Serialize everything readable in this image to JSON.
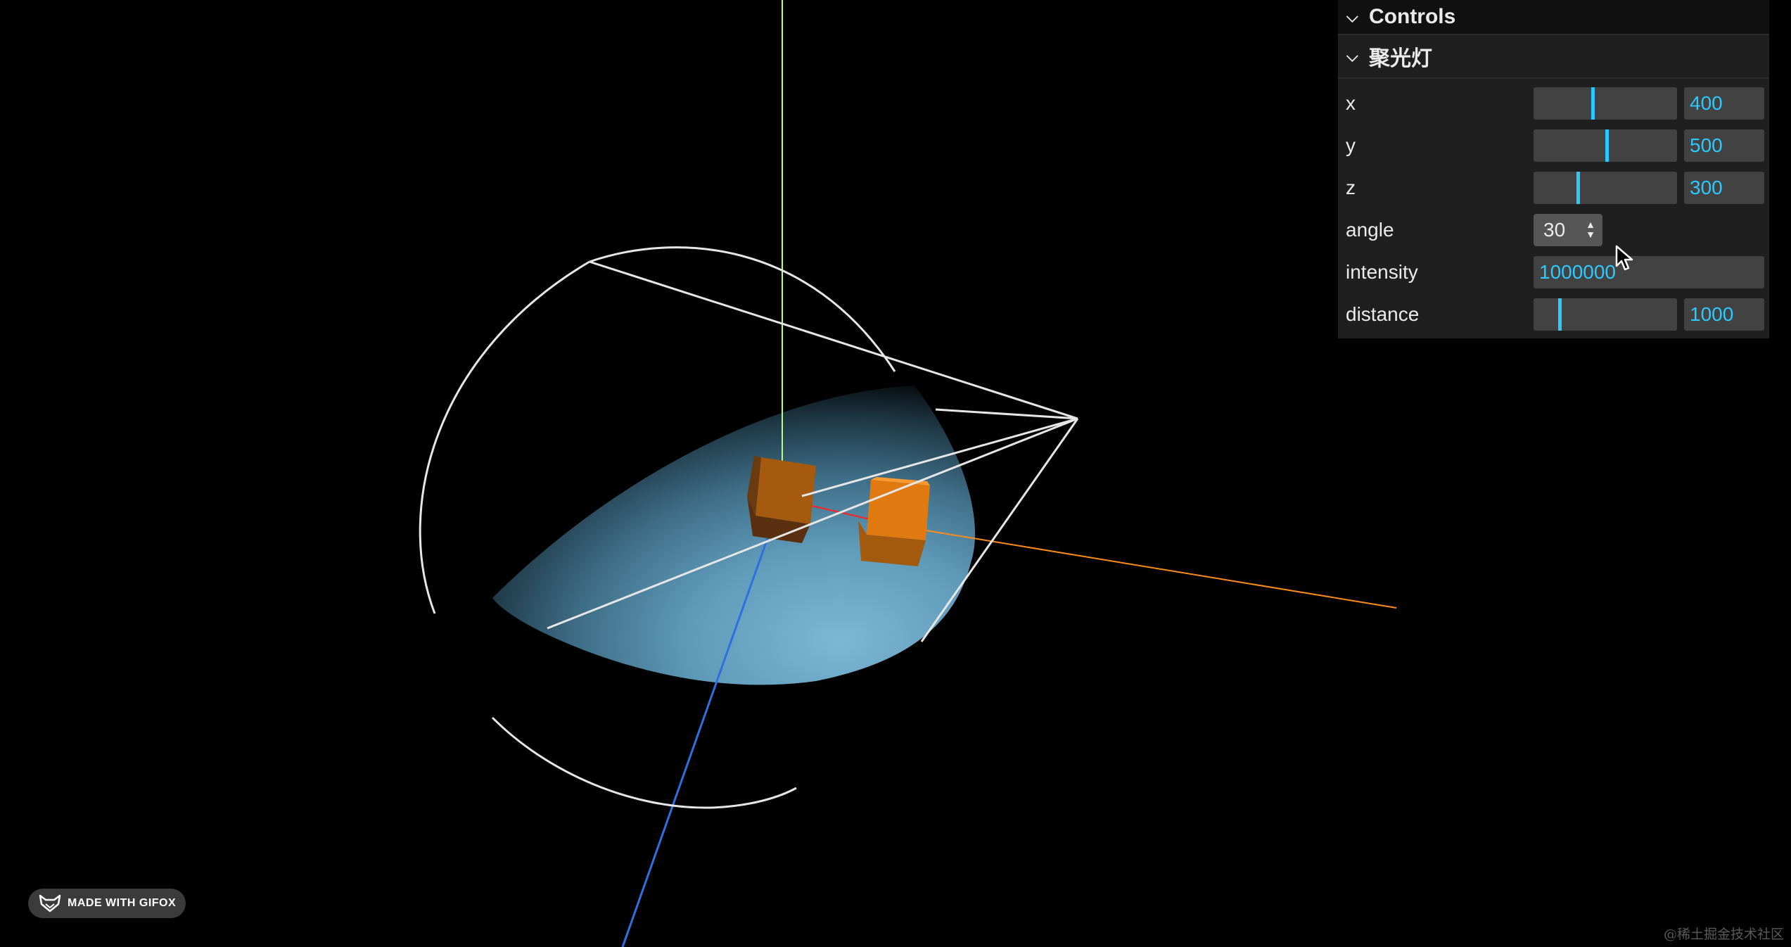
{
  "gui": {
    "title": "Controls",
    "folder_title": "聚光灯",
    "params": {
      "x": {
        "label": "x",
        "value": "400",
        "fraction": 0.4
      },
      "y": {
        "label": "y",
        "value": "500",
        "fraction": 0.5
      },
      "z": {
        "label": "z",
        "value": "300",
        "fraction": 0.3
      },
      "angle": {
        "label": "angle",
        "value": "30"
      },
      "intensity": {
        "label": "intensity",
        "value": "1000000"
      },
      "distance": {
        "label": "distance",
        "value": "1000",
        "fraction": 0.17
      }
    }
  },
  "badge": {
    "text": "MADE WITH GIFOX"
  },
  "watermark": {
    "text": "@稀土掘金技术社区"
  },
  "colors": {
    "accent": "#2cc9ff",
    "panel_bg": "#1f1f1f",
    "input_bg": "#424242",
    "cube": "#e07a10",
    "axis_x": "#ff8c1a",
    "axis_y": "#b8ff7a",
    "axis_z": "#2f6fe0"
  },
  "icons": {
    "folder_chevron": "chevron-down-icon",
    "select_arrows": "up-down-arrows-icon",
    "cursor": "mouse-pointer-icon",
    "gifox_logo": "fox-logo-icon"
  }
}
